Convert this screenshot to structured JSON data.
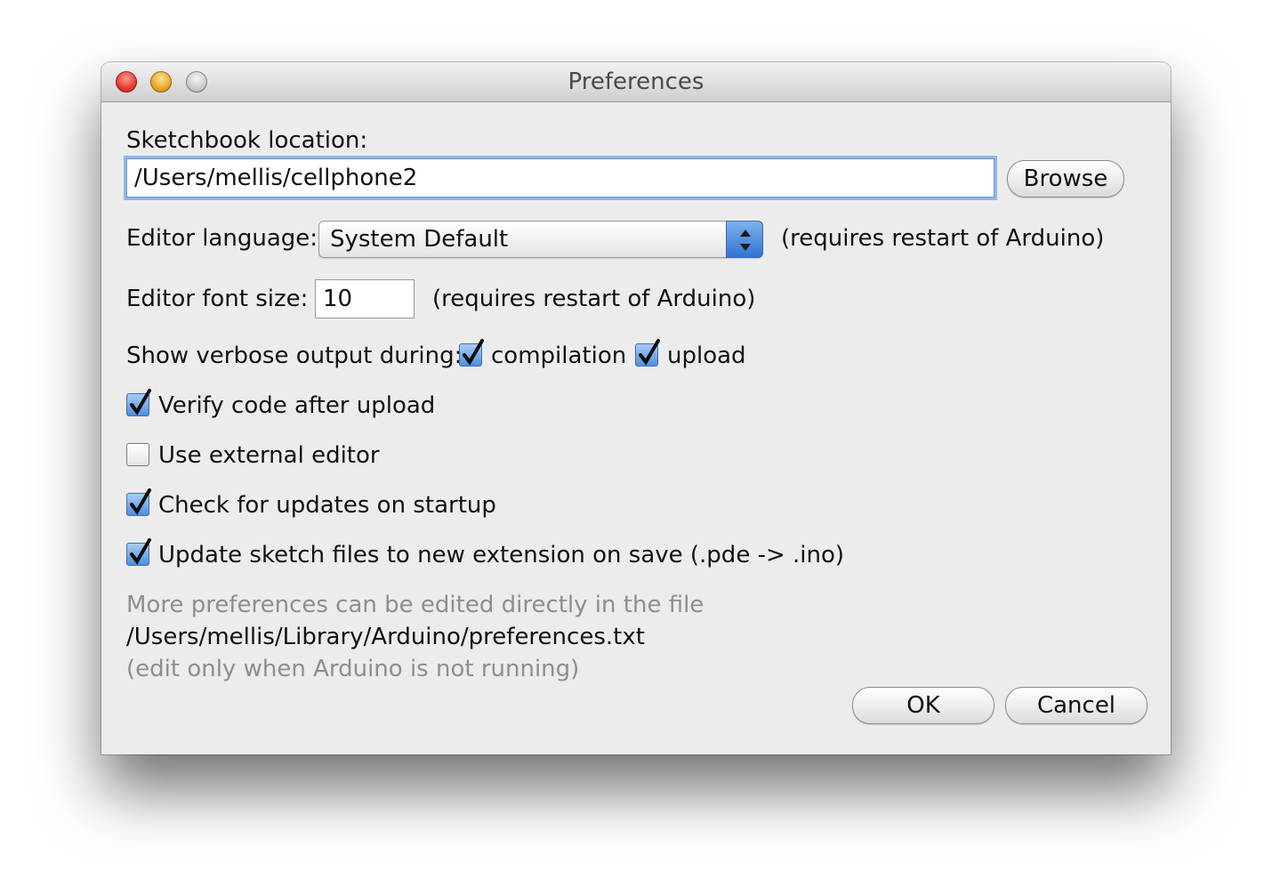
{
  "window": {
    "title": "Preferences"
  },
  "sketchbook": {
    "label": "Sketchbook location:",
    "value": "/Users/mellis/cellphone2",
    "browse_label": "Browse"
  },
  "language": {
    "label": "Editor language:",
    "selected": "System Default",
    "note": "(requires restart of Arduino)"
  },
  "font_size": {
    "label": "Editor font size:",
    "value": "10",
    "note": "(requires restart of Arduino)"
  },
  "verbose": {
    "label": "Show verbose output during:",
    "compilation": {
      "label": "compilation",
      "checked": true
    },
    "upload": {
      "label": "upload",
      "checked": true
    }
  },
  "options": [
    {
      "label": "Verify code after upload",
      "checked": true
    },
    {
      "label": "Use external editor",
      "checked": false
    },
    {
      "label": "Check for updates on startup",
      "checked": true
    },
    {
      "label": "Update sketch files to new extension on save (.pde -> .ino)",
      "checked": true
    }
  ],
  "info": {
    "line1": "More preferences can be edited directly in the file",
    "path": "/Users/mellis/Library/Arduino/preferences.txt",
    "line3": "(edit only when Arduino is not running)"
  },
  "buttons": {
    "ok_label": "OK",
    "cancel_label": "Cancel"
  },
  "colors": {
    "accent": "#4e8fdc",
    "focus_ring": "#8eb8e8",
    "muted_text": "#8e8e8e"
  }
}
